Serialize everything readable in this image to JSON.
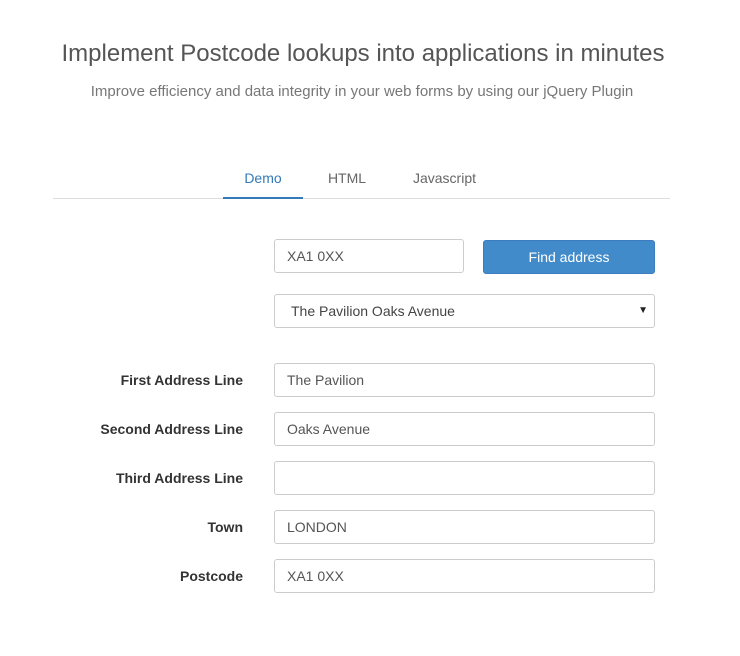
{
  "header": {
    "title": "Implement Postcode lookups into applications in minutes",
    "subtitle": "Improve efficiency and data integrity in your web forms by using our jQuery Plugin"
  },
  "tabs": [
    {
      "label": "Demo",
      "active": true
    },
    {
      "label": "HTML",
      "active": false
    },
    {
      "label": "Javascript",
      "active": false
    }
  ],
  "lookup": {
    "postcode_value": "XA1 0XX",
    "find_button_label": "Find address",
    "address_select_value": "The Pavilion Oaks Avenue"
  },
  "form": {
    "fields": [
      {
        "label": "First Address Line",
        "value": "The Pavilion"
      },
      {
        "label": "Second Address Line",
        "value": "Oaks Avenue"
      },
      {
        "label": "Third Address Line",
        "value": ""
      },
      {
        "label": "Town",
        "value": "LONDON"
      },
      {
        "label": "Postcode",
        "value": "XA1 0XX"
      }
    ]
  },
  "colors": {
    "accent": "#337ab7",
    "button": "#428bca"
  }
}
